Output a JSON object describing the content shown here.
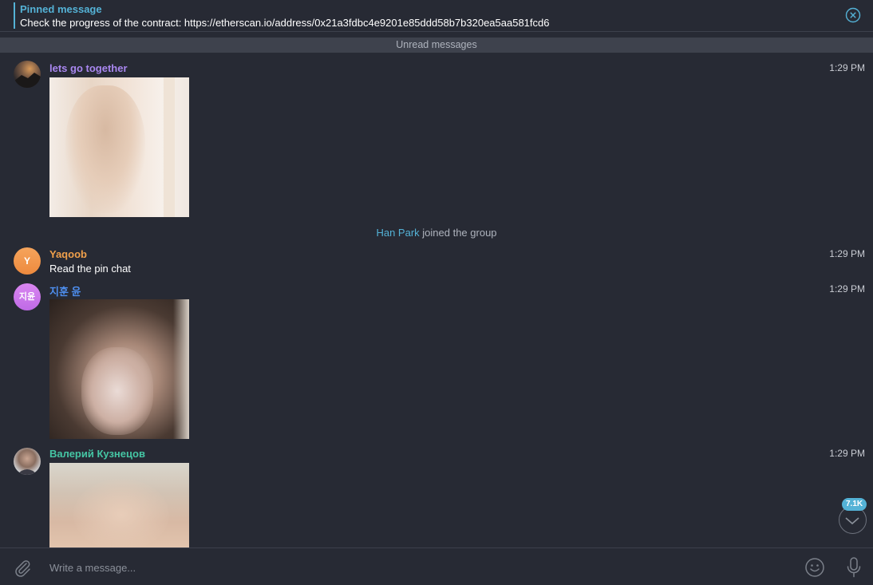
{
  "pinned": {
    "title": "Pinned message",
    "text": "Check the progress of the contract:  https://etherscan.io/address/0x21a3fdbc4e9201e85ddd58b7b320ea5aa581fcd6",
    "close_icon": "close-circle-icon"
  },
  "unread_label": "Unread messages",
  "messages": [
    {
      "author": "lets go together",
      "author_color": "#a987f0",
      "time": "1:29 PM",
      "type": "photo"
    },
    {
      "author": "Yaqoob",
      "author_color": "#f0a04b",
      "avatar_initials": "Y",
      "time": "1:29 PM",
      "text": "Read the pin chat"
    },
    {
      "author": "지훈 윤",
      "author_color": "#4e8ff0",
      "avatar_initials": "지윤",
      "time": "1:29 PM",
      "type": "photo"
    },
    {
      "author": "Валерий Кузнецов",
      "author_color": "#45c6a4",
      "time": "1:29 PM",
      "type": "photo"
    }
  ],
  "service": {
    "name": "Han Park",
    "action": " joined the group"
  },
  "scroll": {
    "badge": "7.1K",
    "icon": "chevron-down-icon"
  },
  "compose": {
    "placeholder": "Write a message...",
    "attach_icon": "paperclip-icon",
    "emoji_icon": "smiley-icon",
    "mic_icon": "microphone-icon"
  },
  "colors": {
    "accent": "#54b2d6",
    "background": "#272a34"
  }
}
